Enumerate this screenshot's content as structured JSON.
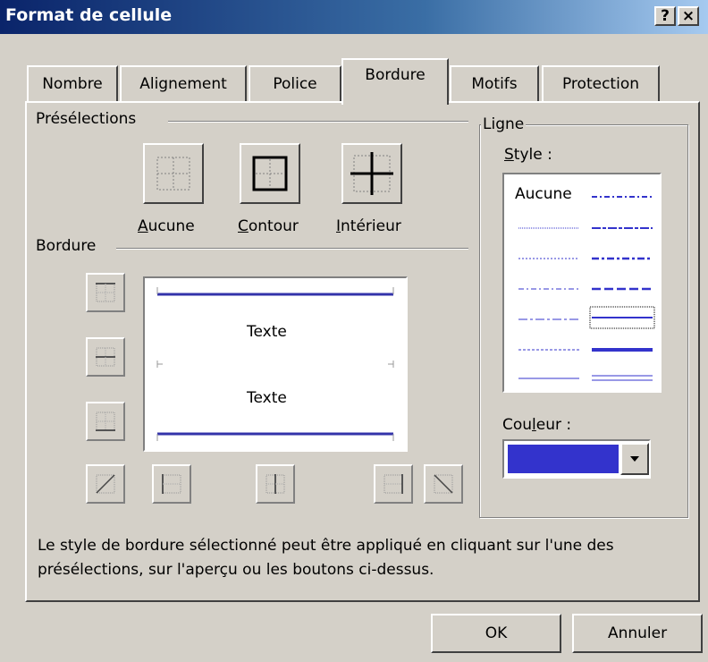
{
  "window": {
    "title": "Format de cellule",
    "help_label": "?",
    "close_label": "×"
  },
  "tabs": [
    {
      "label": "Nombre"
    },
    {
      "label": "Alignement"
    },
    {
      "label": "Police"
    },
    {
      "label": "Bordure",
      "active": true
    },
    {
      "label": "Motifs"
    },
    {
      "label": "Protection"
    }
  ],
  "presets": {
    "heading": "Présélections",
    "none": {
      "accel": "A",
      "rest": "ucune"
    },
    "outline": {
      "accel": "C",
      "rest": "ontour"
    },
    "inside": {
      "accel": "I",
      "rest": "ntérieur"
    }
  },
  "border": {
    "heading": "Bordure",
    "preview_text_top": "Texte",
    "preview_text_bottom": "Texte"
  },
  "line": {
    "heading": "Ligne",
    "style_label_accel": "S",
    "style_label_rest": "tyle :",
    "none_label": "Aucune",
    "color_label_pre": "Cou",
    "color_label_accel": "l",
    "color_label_post": "eur :",
    "selected_color": "#3333cc"
  },
  "hint": "Le style de bordure sélectionné peut être appliqué en cliquant sur l'une des présélections, sur l'aperçu ou les boutons ci-dessus.",
  "buttons": {
    "ok": "OK",
    "cancel": "Annuler"
  }
}
